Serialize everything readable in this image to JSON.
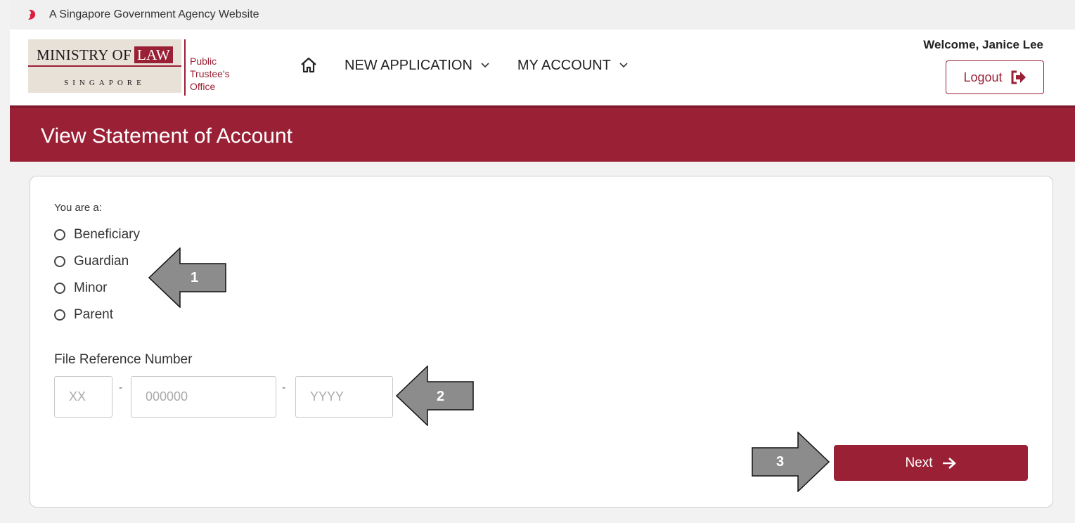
{
  "gov_bar": {
    "text": "A Singapore Government Agency Website"
  },
  "logo": {
    "ministry_prefix": "MINISTRY OF",
    "ministry_suffix": "LAW",
    "country": "SINGAPORE",
    "office_line1": "Public Trustee's",
    "office_line2": "Office"
  },
  "nav": {
    "items": [
      {
        "label": "NEW APPLICATION"
      },
      {
        "label": "MY ACCOUNT"
      }
    ]
  },
  "user": {
    "welcome": "Welcome, Janice Lee",
    "logout_label": "Logout"
  },
  "page": {
    "title": "View Statement of Account"
  },
  "form": {
    "role_label": "You are a:",
    "roles": [
      {
        "label": "Beneficiary"
      },
      {
        "label": "Guardian"
      },
      {
        "label": "Minor"
      },
      {
        "label": "Parent"
      }
    ],
    "file_ref_label": "File Reference Number",
    "file_ref": {
      "part1_placeholder": "XX",
      "part2_placeholder": "000000",
      "part3_placeholder": "YYYY",
      "separator": "-"
    },
    "next_label": "Next"
  },
  "callouts": [
    {
      "label": "1"
    },
    {
      "label": "2"
    },
    {
      "label": "3"
    }
  ],
  "colors": {
    "brand": "#9a2035",
    "callout_fill": "#8c8c8c"
  }
}
